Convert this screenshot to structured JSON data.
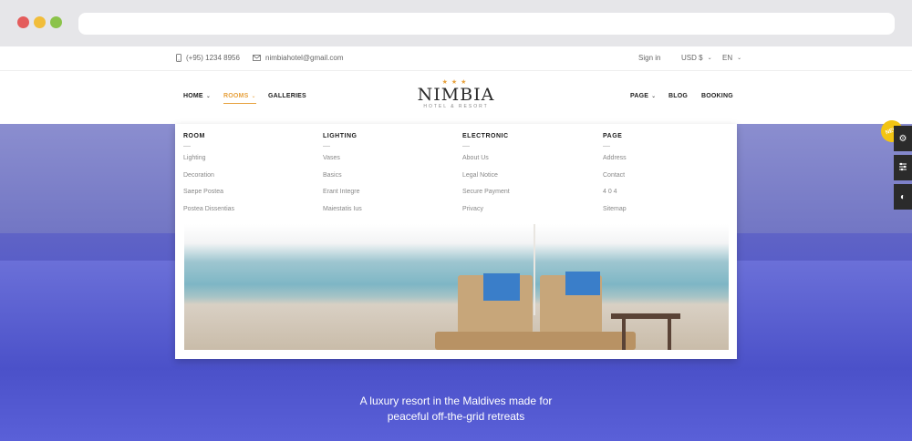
{
  "topbar": {
    "phone": "(+95) 1234 8956",
    "email": "nimbiahotel@gmail.com",
    "signin": "Sign in",
    "currency": "USD $",
    "language": "EN"
  },
  "nav": {
    "home": "HOME",
    "rooms": "ROOMS",
    "galleries": "GALLERIES",
    "page": "PAGE",
    "blog": "BLOG",
    "booking": "BOOKING"
  },
  "logo": {
    "name": "NIMBIA",
    "tagline": "HOTEL & RESORT"
  },
  "mega_menu": {
    "columns": [
      {
        "title": "ROOM",
        "items": [
          "Lighting",
          "Decoration",
          "Saepe Postea",
          "Postea Dissentias"
        ]
      },
      {
        "title": "LIGHTING",
        "items": [
          "Vases",
          "Basics",
          "Erant Integre",
          "Maiestatis Ius"
        ]
      },
      {
        "title": "ELECTRONIC",
        "items": [
          "About Us",
          "Legal Notice",
          "Secure Payment",
          "Privacy"
        ]
      },
      {
        "title": "PAGE",
        "items": [
          "Address",
          "Contact",
          "4 0 4",
          "Sitemap"
        ]
      }
    ]
  },
  "hero": {
    "line1": "A luxury resort in the Maldives made for",
    "line2": "peaceful off-the-grid retreats"
  },
  "badge": "NEW",
  "colors": {
    "accent": "#e7a13d",
    "hero": "#5a60d0"
  }
}
